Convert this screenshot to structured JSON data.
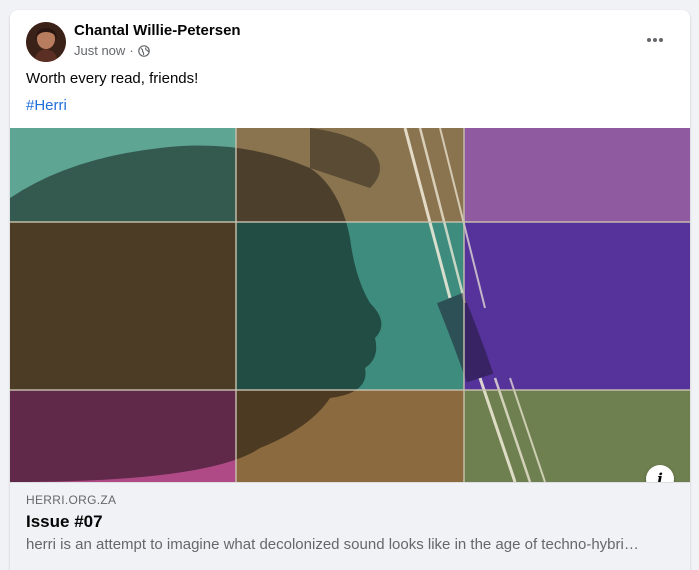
{
  "post": {
    "author": "Chantal Willie-Petersen",
    "timestamp": "Just now",
    "separator": "·",
    "privacy_icon": "globe-icon",
    "text": "Worth every read, friends!",
    "hashtag": "#Herri",
    "more_icon": "more-horizontal-icon"
  },
  "link_preview": {
    "domain": "HERRI.ORG.ZA",
    "title": "Issue #07",
    "description": "herri is an attempt to imagine what decolonized sound looks like in the age of techno-hybri…",
    "info_icon_label": "i"
  },
  "colors": {
    "link_blue": "#216fdb",
    "secondary_text": "#65676b",
    "preview_bg": "#f0f2f5"
  }
}
